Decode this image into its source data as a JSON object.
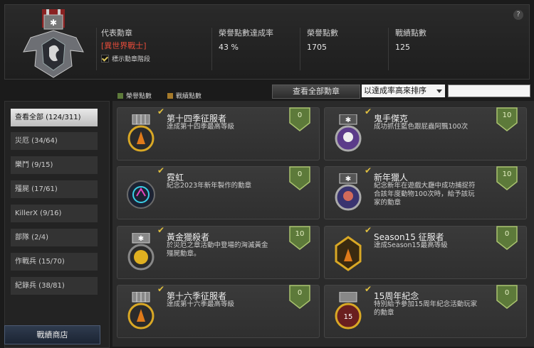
{
  "help_label": "?",
  "header": {
    "representative_label": "代表勳章",
    "representative_name": "[異世界戰士]",
    "show_tier_label": "標示勳章階段",
    "completion_label": "榮譽點數達成率",
    "completion_value": "43 %",
    "honor_label": "榮譽點數",
    "honor_value": "1705",
    "record_label": "戰績點數",
    "record_value": "125"
  },
  "legend": {
    "honor": "榮譽點數",
    "record": "戰績點數"
  },
  "toolbar": {
    "view_all": "查看全部勳章",
    "sort_selected": "以達成率高來排序",
    "search_value": ""
  },
  "sidebar": {
    "items": [
      {
        "label": "查看全部 (124/311)"
      },
      {
        "label": "災厄 (34/64)"
      },
      {
        "label": "樂鬥 (9/15)"
      },
      {
        "label": "殭屍 (17/61)"
      },
      {
        "label": "KillerX (9/16)"
      },
      {
        "label": "部隊 (2/4)"
      },
      {
        "label": "作戰兵 (15/70)"
      },
      {
        "label": "紀錄兵 (38/81)"
      }
    ],
    "shop_button": "戰績商店"
  },
  "medals": [
    {
      "title": "第十四季征服者",
      "desc": "達成第十四季最高等級",
      "points": "0"
    },
    {
      "title": "鬼手傑克",
      "desc": "成功抓住藍色跟屁蟲阿飄100次",
      "points": "10"
    },
    {
      "title": "霓虹",
      "desc": "紀念2023年新年製作的勳章",
      "points": "0"
    },
    {
      "title": "新年獵人",
      "desc": "紀念新年在遊戲大廳中成功捕捉符合該年度動物100次時，給予該玩家的勳章",
      "points": "10"
    },
    {
      "title": "黃金獵殺者",
      "desc": "於災厄之章活動中登場的洶滅黃金殭屍勳章。",
      "points": "10"
    },
    {
      "title": "Season15 征服者",
      "desc": "達成Season15最高等級",
      "points": "0"
    },
    {
      "title": "第十六季征服者",
      "desc": "達成第十六季最高等級",
      "points": "0"
    },
    {
      "title": "15周年紀念",
      "desc": "特別給予參加15周年紀念活動玩家的勳章",
      "points": "0"
    }
  ],
  "colors": {
    "accent_red": "#e34b3a",
    "shield_green": "#5d7a3a",
    "gold": "#d9a825"
  }
}
